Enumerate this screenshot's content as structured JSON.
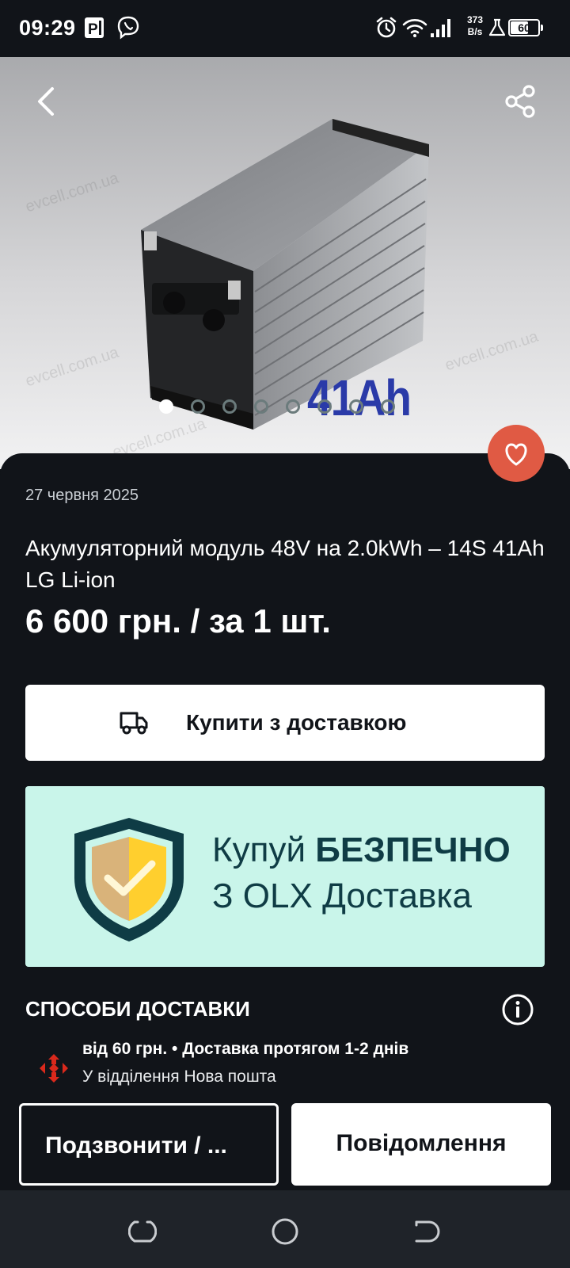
{
  "status_bar": {
    "time": "09:29",
    "net_speed_value": "373",
    "net_speed_unit": "B/s",
    "battery_level": "60",
    "icons": [
      "parking-app-icon",
      "viber-icon",
      "alarm-icon",
      "wifi-icon",
      "signal-icon",
      "lab-icon",
      "battery-icon"
    ]
  },
  "gallery": {
    "image_text": "41Ah",
    "watermark": "evcell.com.ua",
    "photo_count": 8,
    "active_photo": 1
  },
  "listing": {
    "date": "27 червня 2025",
    "title": "Акумуляторний модуль 48V на 2.0kWh – 14S 41Ah LG Li-ion",
    "price": "6 600 грн. / за 1 шт."
  },
  "buy_button": {
    "label": "Купити з доставкою",
    "icon": "truck-icon"
  },
  "banner": {
    "line1_regular": "Купуй ",
    "line1_bold": "БЕЗПЕЧНО",
    "line2": "З OLX Доставка"
  },
  "delivery": {
    "heading": "СПОСОБИ ДОСТАВКИ",
    "price_line": "від 60 грн. • Доставка протягом 1-2 днів",
    "point": "У відділення Нова пошта"
  },
  "actions": {
    "call": "Подзвонити / ...",
    "message": "Повідомлення"
  },
  "colors": {
    "background": "#111419",
    "favorite": "#e05a44",
    "banner_bg": "#c9f5ea",
    "banner_text": "#0f3c45",
    "np_red": "#da291c",
    "image_label": "#2a3aa8"
  }
}
